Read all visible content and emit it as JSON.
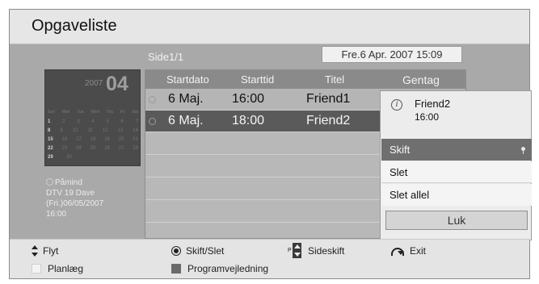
{
  "header": {
    "title": "Opgaveliste"
  },
  "page_info": "Side1/1",
  "datetime": "Fre.6 Apr. 2007 15:09",
  "calendar": {
    "year": "2007",
    "month": "04",
    "dow": [
      "Sun",
      "Mon",
      "Tue",
      "Wed",
      "Thu",
      "Fri",
      "Sat"
    ],
    "weeks": [
      [
        "1",
        "2",
        "3",
        "4",
        "5",
        "6",
        "7"
      ],
      [
        "8",
        "9",
        "10",
        "11",
        "12",
        "13",
        "14"
      ],
      [
        "15",
        "16",
        "17",
        "18",
        "19",
        "20",
        "21"
      ],
      [
        "22",
        "23",
        "24",
        "25",
        "26",
        "27",
        "28"
      ],
      [
        "29",
        "30",
        "",
        "",
        "",
        "",
        ""
      ]
    ]
  },
  "reminder": {
    "label": "Påmind",
    "line1": "DTV 19 Dave",
    "line2": "(Fri.)06/05/2007",
    "line3": "16:00"
  },
  "table": {
    "headers": [
      "Startdato",
      "Starttid",
      "Titel",
      "Gentag"
    ],
    "rows": [
      {
        "date": "6 Maj.",
        "time": "16:00",
        "title": "Friend1"
      },
      {
        "date": "6 Maj.",
        "time": "18:00",
        "title": "Friend2"
      }
    ]
  },
  "popup": {
    "name": "Friend2",
    "time": "16:00",
    "info_icon_glyph": "i",
    "menu": [
      "Skift",
      "Slet",
      "Slet allel"
    ],
    "close_label": "Luk"
  },
  "footer": {
    "flyt": "Flyt",
    "skift_slet": "Skift/Slet",
    "sideskift_prefix": "P",
    "sideskift": "Sideskift",
    "exit": "Exit",
    "planlaeg": "Planlæg",
    "programvejledning": "Programvejledning"
  },
  "icons": {
    "updown": "up-down-arrows-icon",
    "ok": "ok-button-icon",
    "page": "page-up-down-icon",
    "exit": "return-arrow-icon",
    "clock": "clock-icon",
    "info": "info-icon"
  },
  "colors": {
    "frame": "#a9a9a9",
    "selected_row": "#5a5a5a",
    "selected_menu": "#6f6f6f",
    "yellow_square": "#f4f4f4",
    "blue_square": "#6a6a6a"
  }
}
